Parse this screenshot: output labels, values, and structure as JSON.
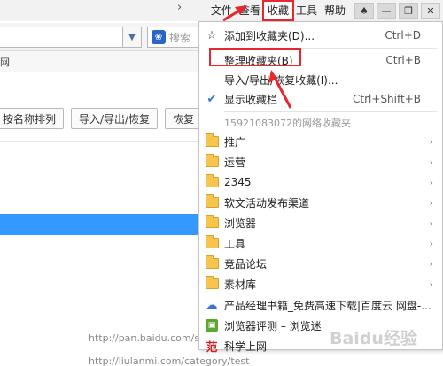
{
  "menubar": {
    "items": [
      "文件",
      "查看",
      "收藏",
      "工具",
      "帮助"
    ],
    "chevron": "›"
  },
  "search": {
    "placeholder": "搜索"
  },
  "favbar_strip": {
    "text": "网"
  },
  "toolbar": {
    "buttons": [
      "按名称排列",
      "导入/导出/恢复",
      "恢复"
    ]
  },
  "dropdown": {
    "add_label": "添加到收藏夹(D)...",
    "add_shortcut": "Ctrl+D",
    "organize_label": "整理收藏夹(B)",
    "organize_shortcut": "Ctrl+B",
    "import_label": "导入/导出/恢复收藏(I)...",
    "showbar_label": "显示收藏栏",
    "showbar_shortcut": "Ctrl+Shift+B",
    "section_header": "15921083072的网络收藏夹",
    "folders": [
      "推广",
      "运营",
      "2345",
      "软文活动发布渠道",
      "浏览器",
      "工具",
      "竞品论坛",
      "素材库"
    ],
    "links": [
      "产品经理书籍_免费高速下载|百度云 网盘-...",
      "浏览器评测 – 浏览迷",
      "科学上网"
    ]
  },
  "bottom_urls": [
    "http://pan.baidu.com/s/",
    "http://liulanmi.com/category/test"
  ],
  "watermark": "Baidu经验",
  "colors": {
    "accent": "#e8262d",
    "selection": "#3399ff",
    "folder": "#f6c44f"
  },
  "icons": {
    "star": "star-outline-icon",
    "check": "checkmark-icon",
    "folder": "folder-icon",
    "cloud": "baidu-cloud-icon",
    "green": "liulanmi-icon",
    "red": "fan-icon"
  }
}
